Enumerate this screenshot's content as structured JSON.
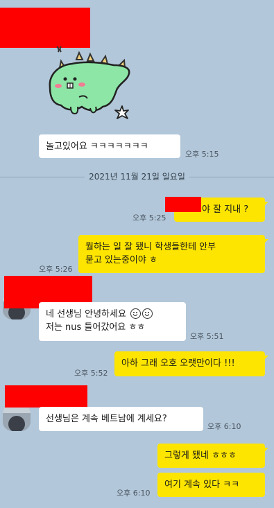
{
  "chat": {
    "messages": [
      {
        "id": 1,
        "side": "in",
        "text": "놀고있어요 ㅋㅋㅋㅋㅋㅋㅋ",
        "time": "오후 5:15"
      },
      {
        "id": 2,
        "side": "out",
        "text": "야 잘 지내 ?",
        "time": "오후 5:25"
      },
      {
        "id": 3,
        "side": "out",
        "line1": "뭘하는 일 잘 됐니 학생들한테 안부",
        "line2": "묻고 있는중이야 ㅎ",
        "time": "오후 5:26"
      },
      {
        "id": 4,
        "side": "in",
        "line1": "네 선생님 안녕하세요",
        "line2": "저는 nus 들어갔어요 ㅎㅎ",
        "time": "오후 5:51"
      },
      {
        "id": 5,
        "side": "out",
        "text": "아하 그래 오호 오랫만이다 !!!",
        "time": "오후 5:52"
      },
      {
        "id": 6,
        "side": "in",
        "text": "선생님은 계속 베트남에 계세요?",
        "time": "오후 6:10"
      },
      {
        "id": 7,
        "side": "out",
        "text": "그렇게 됐네 ㅎㅎㅎ",
        "time": ""
      },
      {
        "id": 8,
        "side": "out",
        "text": "여기 계속 있다 ㅋㅋ",
        "time": "오후 6:10"
      }
    ]
  },
  "date_divider": "2021년 11월 21일 일요일",
  "sticker": {
    "icon": "dinosaur-sticker-icon",
    "sparkle_icon": "sparkle-icon"
  },
  "colors": {
    "background": "#b2c7d9",
    "outgoing_bubble": "#fee500",
    "incoming_bubble": "#ffffff",
    "redaction": "#ff0000",
    "sticker_body": "#8de6a6"
  }
}
